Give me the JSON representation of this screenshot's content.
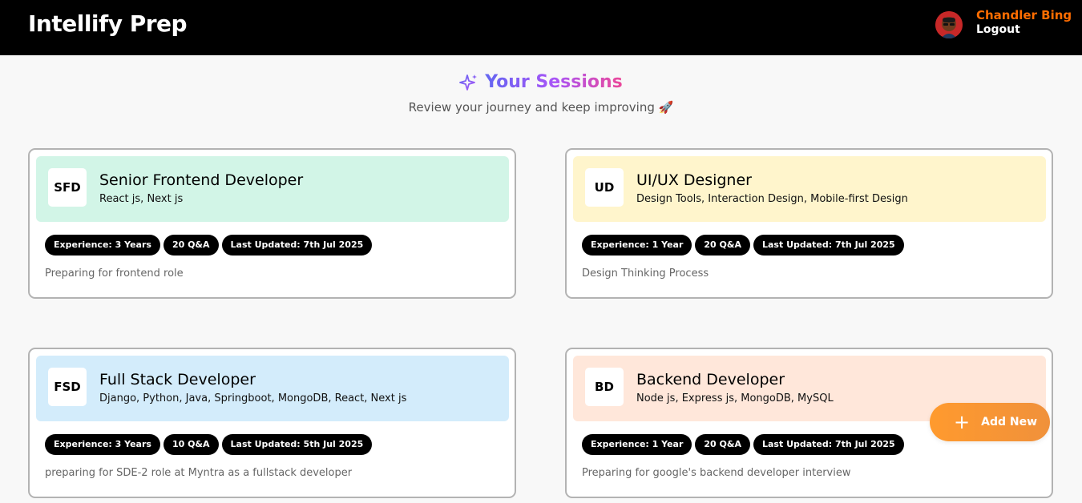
{
  "header": {
    "brand": "Intellify Prep",
    "user_name": "Chandler Bing",
    "logout_label": "Logout"
  },
  "page": {
    "title": "Your Sessions",
    "subtitle": "Review your journey and keep improving 🚀"
  },
  "sessions": [
    {
      "initials": "SFD",
      "role": "Senior Frontend Developer",
      "topics": "React js, Next js",
      "experience": "Experience: 3 Years",
      "qa": "20 Q&A",
      "updated": "Last Updated: 7th Jul 2025",
      "description": "Preparing for frontend role",
      "color": "#d2f5e7"
    },
    {
      "initials": "UD",
      "role": "UI/UX Designer",
      "topics": "Design Tools, Interaction Design, Mobile-first Design",
      "experience": "Experience: 1 Year",
      "qa": "20 Q&A",
      "updated": "Last Updated: 7th Jul 2025",
      "description": "Design Thinking Process",
      "color": "#fff5cc"
    },
    {
      "initials": "FSD",
      "role": "Full Stack Developer",
      "topics": "Django, Python, Java, Springboot, MongoDB, React, Next js",
      "experience": "Experience: 3 Years",
      "qa": "10 Q&A",
      "updated": "Last Updated: 5th Jul 2025",
      "description": "preparing for SDE-2 role at Myntra as a fullstack developer",
      "color": "#d3ecfb"
    },
    {
      "initials": "BD",
      "role": "Backend Developer",
      "topics": "Node js, Express js, MongoDB, MySQL",
      "experience": "Experience: 1 Year",
      "qa": "20 Q&A",
      "updated": "Last Updated: 7th Jul 2025",
      "description": "Preparing for google's backend developer interview",
      "color": "#ffe7da"
    }
  ],
  "fab": {
    "label": "Add New",
    "icon": "plus-icon"
  },
  "colors": {
    "navbar": "#000000",
    "user_name": "#ff6d00",
    "accent_orange": "#f7962f",
    "tag_bg": "#000000"
  }
}
